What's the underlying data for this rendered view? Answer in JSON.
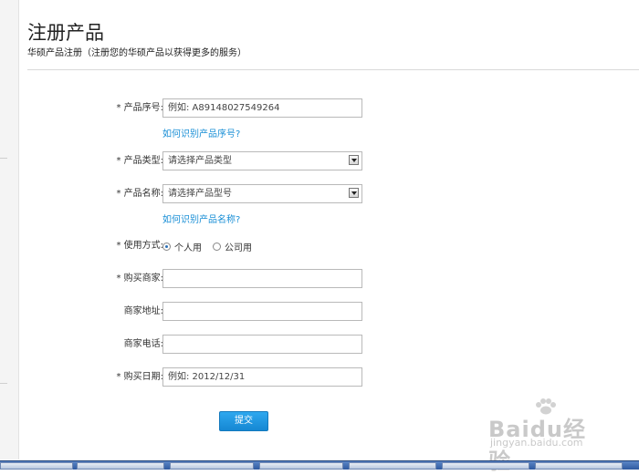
{
  "page": {
    "title": "注册产品",
    "subtitle": "华硕产品注册（注册您的华硕产品以获得更多的服务）"
  },
  "form": {
    "serial": {
      "label": "* 产品序号:",
      "placeholder": "例如: A89148027549264",
      "help": "如何识别产品序号?"
    },
    "category": {
      "label": "* 产品类型:",
      "selected": "请选择产品类型"
    },
    "model": {
      "label": "* 产品名称:",
      "selected": "请选择产品型号",
      "help": "如何识别产品名称?"
    },
    "usage": {
      "label": "* 使用方式:",
      "options": [
        "个人用",
        "公司用"
      ],
      "selected": "个人用"
    },
    "dealer": {
      "label": "* 购买商家:",
      "value": ""
    },
    "dealer_address": {
      "label": "商家地址:",
      "value": ""
    },
    "dealer_phone": {
      "label": "商家电话:",
      "value": ""
    },
    "purchase_date": {
      "label": "* 购买日期:",
      "placeholder": "例如: 2012/12/31"
    },
    "submit_label": "提交"
  },
  "watermark": {
    "main": "Baidu经验",
    "sub": "jingyan.baidu.com"
  },
  "colors": {
    "link": "#1a8fd6",
    "button": "#1f97e1",
    "divider": "#d9d9d9"
  }
}
